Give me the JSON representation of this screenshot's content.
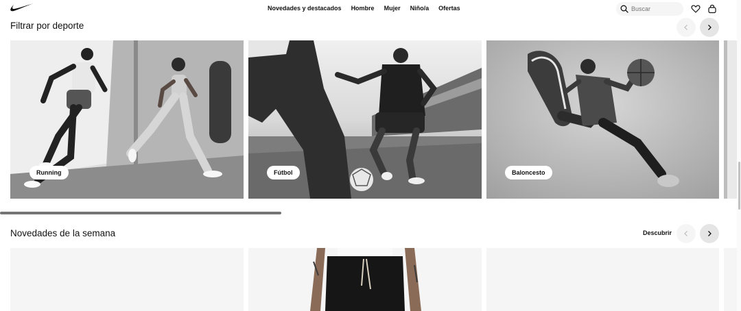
{
  "header": {
    "nav": [
      "Novedades y destacados",
      "Hombre",
      "Mujer",
      "Niño/a",
      "Ofertas"
    ],
    "search_placeholder": "Buscar"
  },
  "sport_section": {
    "title": "Filtrar por deporte",
    "cards": [
      {
        "label": "Running"
      },
      {
        "label": "Fútbol"
      },
      {
        "label": "Baloncesto"
      }
    ]
  },
  "new_section": {
    "title": "Novedades de la semana",
    "discover_label": "Descubrir"
  },
  "icons": {
    "logo": "nike-swoosh-logo",
    "search": "search-icon",
    "favorites": "heart-icon",
    "bag": "bag-icon",
    "prev": "chevron-left-icon",
    "next": "chevron-right-icon"
  },
  "colors": {
    "text": "#111111",
    "chip_bg": "#ffffff",
    "disabled_btn": "#f5f5f5",
    "enabled_btn": "#e5e5e5"
  }
}
